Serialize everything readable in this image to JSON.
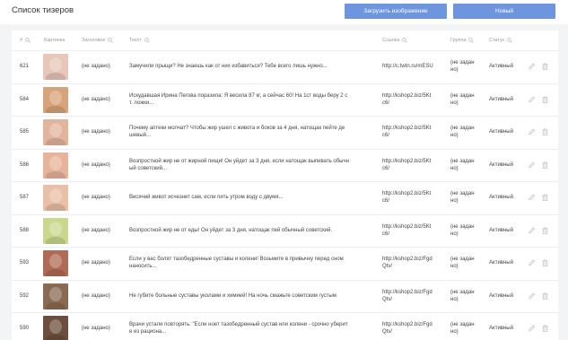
{
  "header": {
    "title": "Список тизеров",
    "upload_label": "Загрузить изображение",
    "new_label": "Новый"
  },
  "table": {
    "columns": {
      "id": "#",
      "image": "Картинка",
      "headline": "Заголовок",
      "text": "Текст",
      "link": "Ссылка",
      "group": "Группа",
      "status": "Статус"
    },
    "rows": [
      {
        "id": "621",
        "headline": "(не задано)",
        "text": [
          "Замучили прыщи? Не знаешь как от них избавиться? Тебе всего лишь нужно..."
        ],
        "link": [
          "http://c.twtn.ru/mESU"
        ],
        "group": [
          "(не задан",
          "но)"
        ],
        "status": "Активный",
        "thumb": "#e8c7b8"
      },
      {
        "id": "584",
        "headline": "(не задано)",
        "text": [
          "Искудавшая Ирина Пегова поразила: Я весила 87 кг, а сейчас 60! На 1ст воды беру 2 с",
          "т. ложки..."
        ],
        "link": [
          "http://kshop2.biz/5Kt",
          "c6/"
        ],
        "group": [
          "(не задан",
          "но)"
        ],
        "status": "Активный",
        "thumb": "#d9a37a"
      },
      {
        "id": "585",
        "headline": "(не задано)",
        "text": [
          "Почему аптеки молчат? Чтобы жир ушел с живота и боков за 4 дня, натощак пейте де",
          "шевый..."
        ],
        "link": [
          "http://kshop2.biz/5Kt",
          "c6/"
        ],
        "group": [
          "(не задан",
          "но)"
        ],
        "status": "Активный",
        "thumb": "#e3b49c"
      },
      {
        "id": "586",
        "headline": "(не задано)",
        "text": [
          "Возпростной жир не от жирной пищи! Он уйдет за 3 дня, если натощак выпивать обычн",
          "ый советский..."
        ],
        "link": [
          "http://kshop2.biz/5Kt",
          "c6/"
        ],
        "group": [
          "(не задан",
          "но)"
        ],
        "status": "Активный",
        "thumb": "#e7b49b"
      },
      {
        "id": "587",
        "headline": "(не задано)",
        "text": [
          "Висячий живот исчезнет сам, если пить утром воду с двумя..."
        ],
        "link": [
          "http://kshop2.biz/5Kt",
          "c6/"
        ],
        "group": [
          "(не задан",
          "но)"
        ],
        "status": "Активный",
        "thumb": "#e9bfa6"
      },
      {
        "id": "588",
        "headline": "(не задано)",
        "text": [
          "Возпростной жир не от еды! Он уйдет за 3 дня, натощак пей обычный советский."
        ],
        "link": [
          "http://kshop2.biz/5Kt",
          "c6/"
        ],
        "group": [
          "(не задан",
          "но)"
        ],
        "status": "Активный",
        "thumb": "#c9d88c"
      },
      {
        "id": "593",
        "headline": "(не задано)",
        "text": [
          "Если у вас болят тазобедренные суставы и колени! Возьмите в привычку перед сном",
          "наносить..."
        ],
        "link": [
          "http://kshop2.biz/Fgd",
          "Qtv/"
        ],
        "group": [
          "(не задан",
          "но)"
        ],
        "status": "Активный",
        "thumb": "#b06a55"
      },
      {
        "id": "592",
        "headline": "(не задано)",
        "text": [
          "Не губите больные суставы уколами и химией! На ночь смажьте советским густым"
        ],
        "link": [
          "http://kshop2.biz/Fgd",
          "Qtv/"
        ],
        "group": [
          "(не задан",
          "но)"
        ],
        "status": "Активный",
        "thumb": "#8a6a52"
      },
      {
        "id": "590",
        "headline": "(не задано)",
        "text": [
          "Врачи устали повторять: \"Если ноет тазобедренный сустав или колени - срочно уберит",
          "е из рациона..."
        ],
        "link": [
          "http://kshop2.biz/Fgd",
          "Qtv/"
        ],
        "group": [
          "(не задан",
          "но)"
        ],
        "status": "Активный",
        "thumb": "#6b4e3d"
      }
    ]
  }
}
